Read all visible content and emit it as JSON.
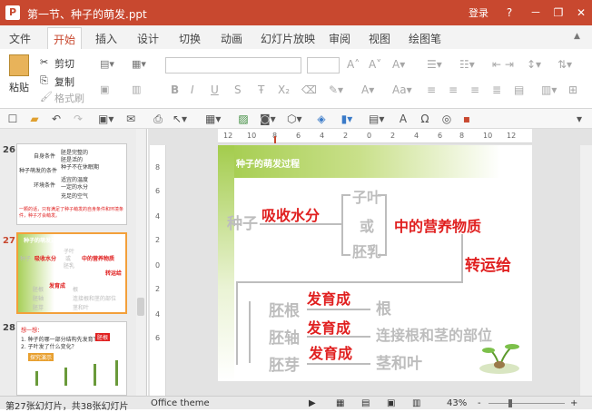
{
  "window": {
    "title": "第一节、种子的萌发.ppt",
    "login": "登录",
    "help": "?",
    "minimize": "－",
    "restore": "❐",
    "close": "✕",
    "app_icon": "P"
  },
  "tabs": [
    "文件",
    "开始",
    "插入",
    "设计",
    "切换",
    "动画",
    "幻灯片放映",
    "审阅",
    "视图",
    "绘图笔"
  ],
  "active_tab": "开始",
  "ribbon": {
    "paste": "粘贴",
    "cut": "剪切",
    "copy": "复制",
    "format_painter": "格式刷"
  },
  "thumbnails": [
    {
      "number": "26",
      "lines": [
        "自身条件",
        "胚是完整的",
        "胚是活的",
        "种子不在休眠期",
        "种子萌发的条件",
        "环境条件",
        "适宜的温度",
        "一定的水分",
        "充足的空气",
        "一颗的话，只有满足了种子萌发的自身条件和环境条件，种子才会萌发。"
      ]
    },
    {
      "number": "27",
      "lines": [
        "种子的萌发过程",
        "种子",
        "吸收水分",
        "子叶",
        "或",
        "胚乳",
        "中的营养物质",
        "转运给",
        "胚根",
        "发育成",
        "根",
        "胚轴",
        "连接根和茎的部位",
        "胚芽",
        "茎和叶"
      ]
    },
    {
      "number": "28",
      "lines": [
        "想一想：",
        "1. 种子的哪一部分结构先发育？",
        "2. 子叶发了什么变化？",
        "胚根",
        "探究演示"
      ]
    }
  ],
  "slide": {
    "title": "种子的萌发过程",
    "seed": "种子",
    "absorb": "吸收水分",
    "cotyledon": "子叶",
    "or": "或",
    "endosperm": "胚乳",
    "nutrients": "中的营养物质",
    "transport": "转运给",
    "rows": [
      {
        "part": "胚根",
        "verb": "发育成",
        "result": "根"
      },
      {
        "part": "胚轴",
        "verb": "发育成",
        "result": "连接根和茎的部位"
      },
      {
        "part": "胚芽",
        "verb": "发育成",
        "result": "茎和叶"
      }
    ]
  },
  "ruler_h": [
    "12",
    "10",
    "8",
    "6",
    "4",
    "2",
    "0",
    "2",
    "4",
    "6",
    "8",
    "10",
    "12"
  ],
  "ruler_v": [
    "8",
    "6",
    "4",
    "2",
    "0",
    "2",
    "4",
    "6"
  ],
  "status": {
    "slide_info": "第27张幻灯片，共38张幻灯片",
    "theme": "Office theme",
    "zoom": "43%",
    "minus": "-",
    "plus": "+"
  }
}
